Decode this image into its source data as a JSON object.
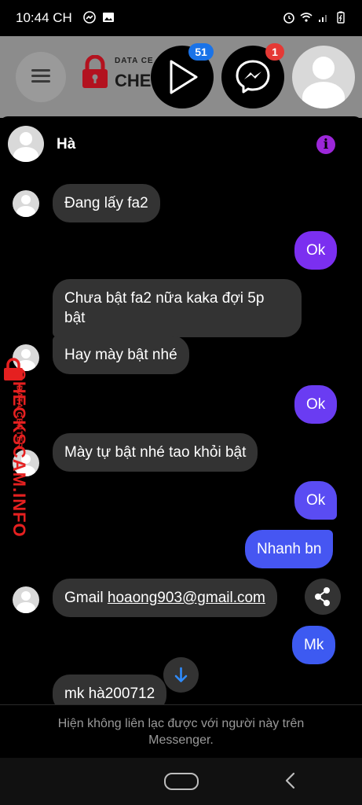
{
  "status_bar": {
    "time": "10:44 CH"
  },
  "background_app": {
    "logo_top": "DATA CE",
    "logo_text": "CHECK"
  },
  "chat_heads": {
    "video_badge": "51",
    "messenger_badge": "1"
  },
  "conversation": {
    "contact_name": "Hà",
    "info_icon": "i",
    "messages": [
      {
        "side": "in",
        "text": "Đang lấy fa2"
      },
      {
        "side": "out",
        "text": "Ok"
      },
      {
        "side": "in",
        "text_line1": "Chưa bật fa2 nữa kaka đợi 5p",
        "text_line2": "bật"
      },
      {
        "side": "in",
        "text": "Hay mày bật nhé"
      },
      {
        "side": "out",
        "text": "Ok"
      },
      {
        "side": "in",
        "text": "Mày tự bật nhé tao khỏi bật"
      },
      {
        "side": "out",
        "text": "Ok"
      },
      {
        "side": "out",
        "text": "Nhanh bn"
      },
      {
        "side": "in",
        "text_prefix": "Gmail ",
        "link": "hoaong903@gmail.com"
      },
      {
        "side": "out",
        "text": "Mk"
      },
      {
        "side": "in",
        "text": "mk hà200712"
      }
    ],
    "footer_note": "Hiện không liên lạc được với người này trên Messenger."
  },
  "watermark": {
    "small": "DATA CENTER",
    "big": "CHECKSCAM.INFO"
  },
  "colors": {
    "incoming_bubble": "#333333",
    "outgoing_purple": "#7b2ff0",
    "outgoing_blue": "#3d5af1",
    "info_icon": "#9c27d9",
    "badge_blue": "#1a73e8",
    "badge_red": "#e53935",
    "watermark": "#e52020"
  },
  "icons": [
    "wifi-icon",
    "alarm-icon",
    "signal-icon",
    "battery-icon",
    "messenger-icon",
    "gallery-icon",
    "play-icon",
    "share-icon",
    "arrow-down-icon",
    "home-pill",
    "back-icon",
    "menu-icon",
    "lock-logo-icon"
  ]
}
